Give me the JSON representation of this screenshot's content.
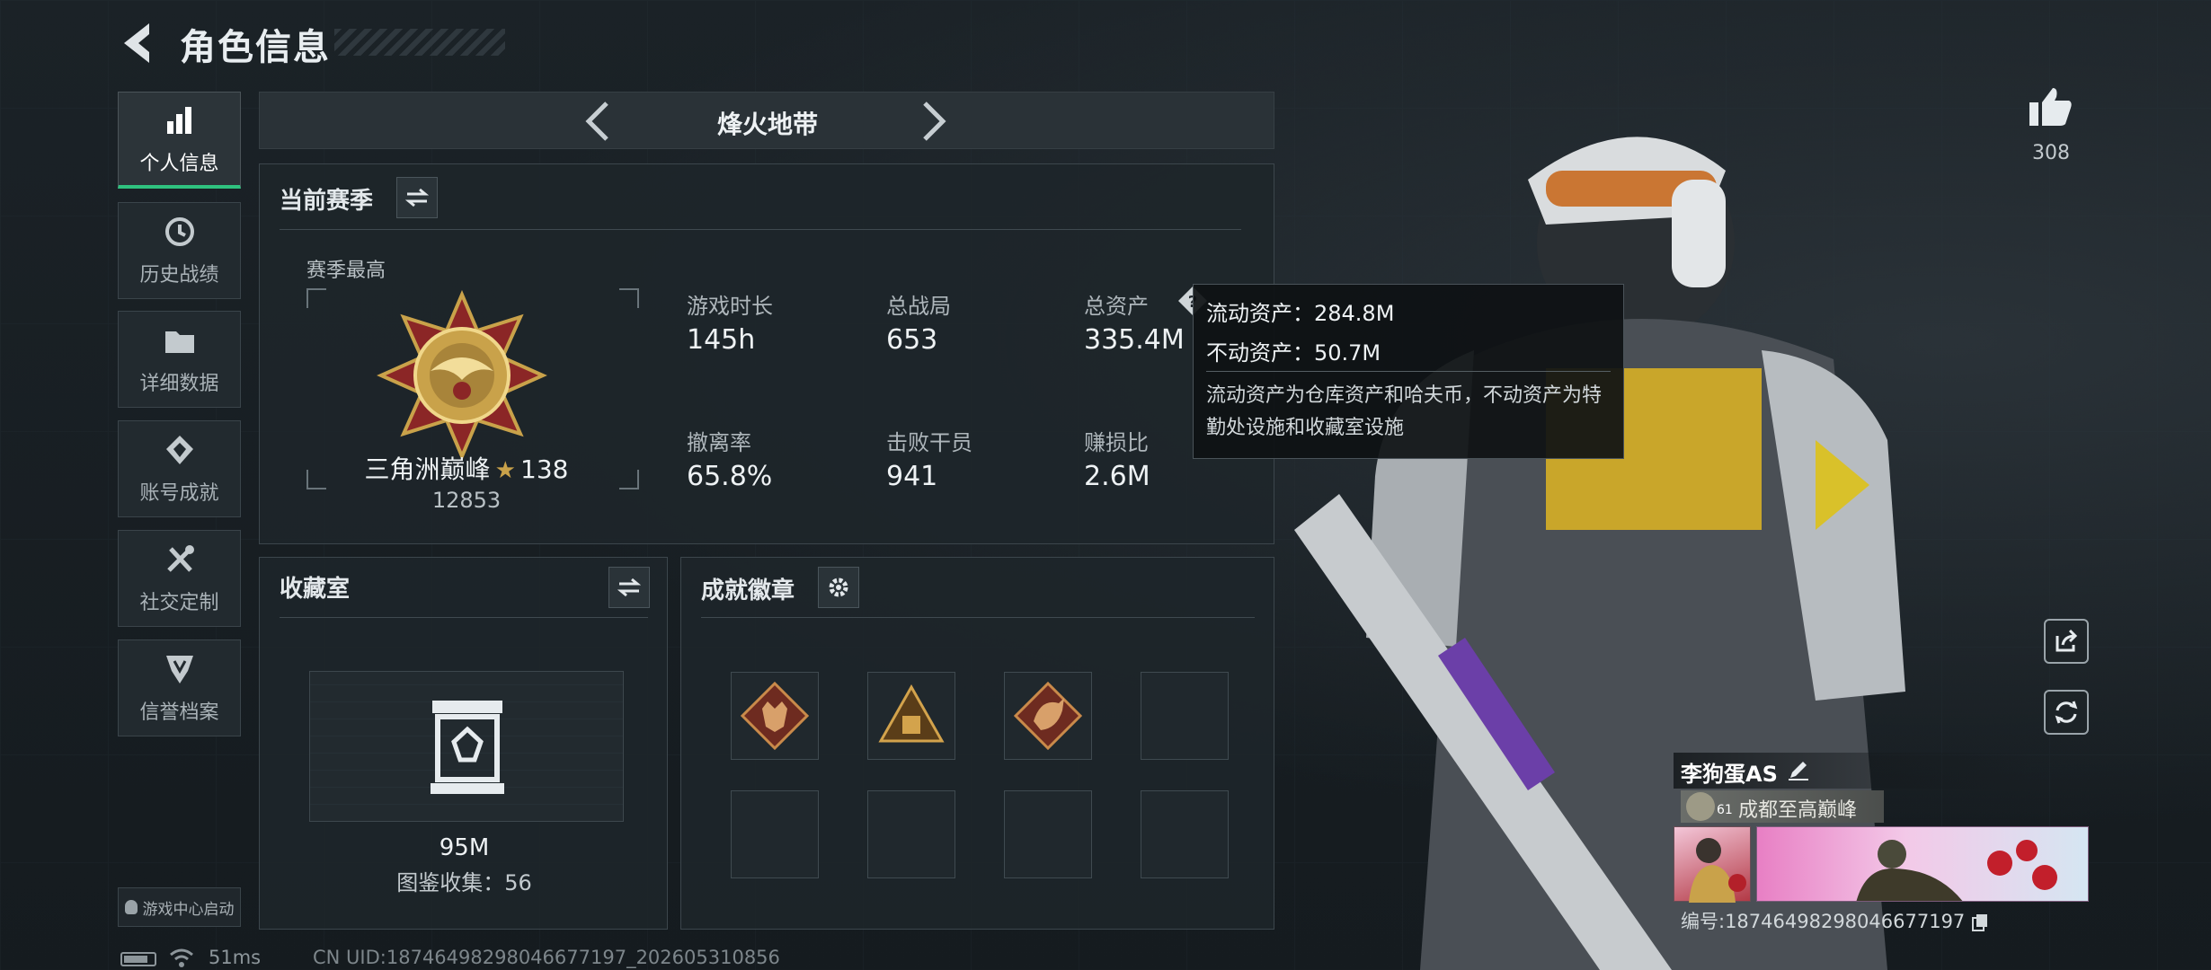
{
  "header": {
    "title": "角色信息"
  },
  "sidebar": {
    "items": [
      {
        "label": "个人信息",
        "icon": "bar-chart-icon",
        "active": true
      },
      {
        "label": "历史战绩",
        "icon": "history-icon"
      },
      {
        "label": "详细数据",
        "icon": "folder-icon"
      },
      {
        "label": "账号成就",
        "icon": "achievement-icon"
      },
      {
        "label": "社交定制",
        "icon": "tools-icon"
      },
      {
        "label": "信誉档案",
        "icon": "credit-shield-icon"
      }
    ],
    "game_center": "游戏中心启动"
  },
  "mode_switcher": {
    "label": "烽火地带"
  },
  "season": {
    "title": "当前赛季",
    "best_label": "赛季最高",
    "rank_name": "三角洲巅峰",
    "rank_stars": "138",
    "rank_score": "12853",
    "stats": [
      {
        "label": "游戏时长",
        "value": "145h"
      },
      {
        "label": "总战局",
        "value": "653"
      },
      {
        "label": "总资产",
        "value": "335.4M"
      },
      {
        "label": "撤离率",
        "value": "65.8%"
      },
      {
        "label": "击败干员",
        "value": "941"
      },
      {
        "label": "赚损比",
        "value": "2.6M"
      }
    ]
  },
  "tooltip": {
    "liquid": "流动资产：284.8M",
    "fixed": "不动资产：50.7M",
    "desc": "流动资产为仓库资产和哈夫币，不动资产为特勤处设施和收藏室设施"
  },
  "collection": {
    "title": "收藏室",
    "value": "95M",
    "catalog": "图鉴收集：56"
  },
  "achievements": {
    "title": "成就徽章"
  },
  "player": {
    "likes": "308",
    "name": "李狗蛋AS",
    "level": "61",
    "title": "成都至高巅峰",
    "id_line": "编号:18746498298046677197"
  },
  "status_bar": {
    "ping": "51ms",
    "uid": "CN UID:18746498298046677197_202605310856"
  },
  "colors": {
    "accent": "#2fc27f",
    "panel": "#1e252a",
    "gold": "#c9a24a"
  }
}
